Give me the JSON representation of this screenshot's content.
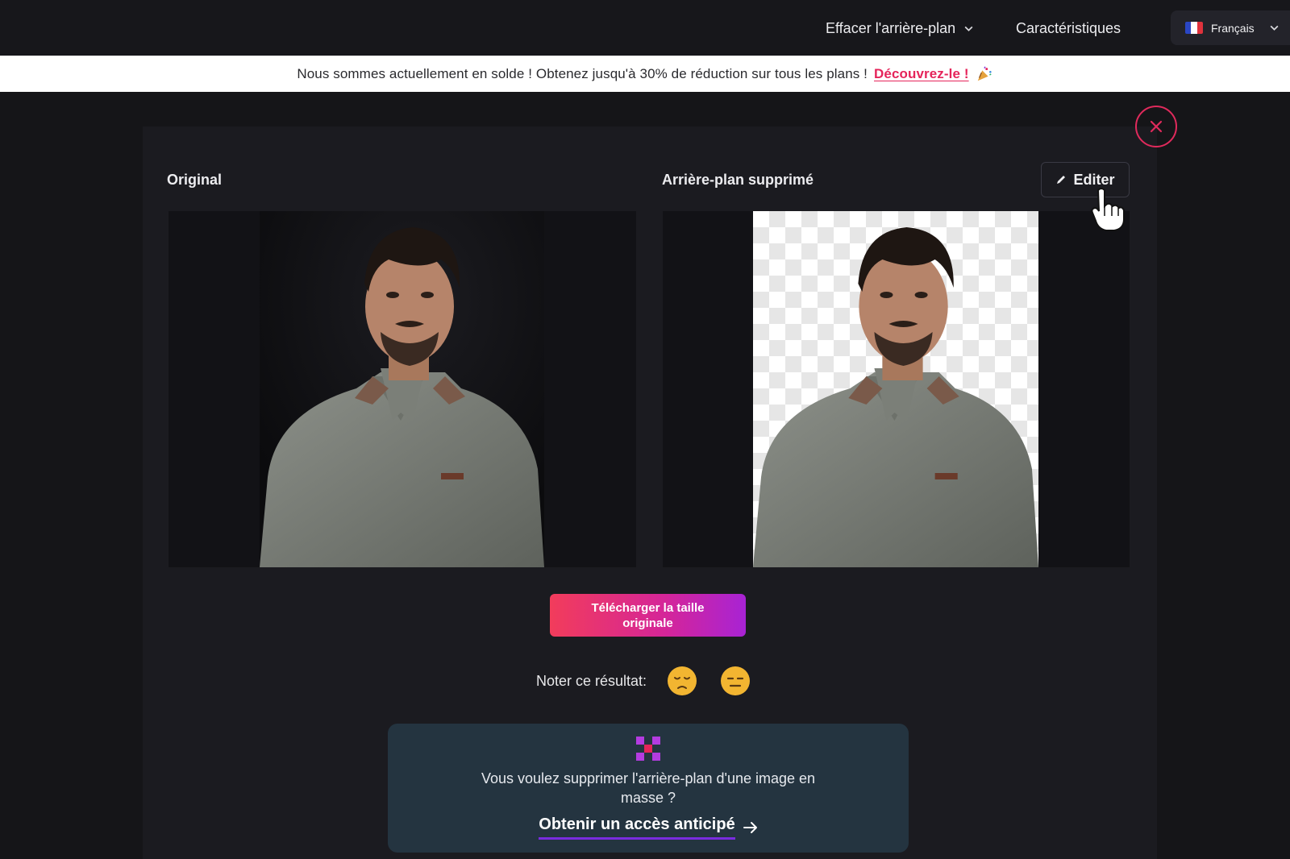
{
  "nav": {
    "remove_bg_label": "Effacer l'arrière-plan",
    "features_label": "Caractéristiques",
    "language_label": "Français"
  },
  "promo": {
    "text": "Nous sommes actuellement en solde ! Obtenez jusqu'à 30% de réduction sur tous les plans !",
    "link": "Découvrez-le !"
  },
  "result": {
    "original_label": "Original",
    "removed_label": "Arrière-plan supprimé",
    "edit_label": "Editer",
    "download_label": "Télécharger la taille originale",
    "rate_label": "Noter ce résultat:"
  },
  "bulk": {
    "text": "Vous voulez supprimer l'arrière-plan d'une image en masse ?",
    "link": "Obtenir un accès anticipé"
  },
  "colors": {
    "accent": "#e5245a",
    "gradient_start": "#f23c5b",
    "gradient_end": "#a823d4",
    "card": "#243440"
  },
  "icons": {
    "language_flag": "france-flag-icon",
    "close": "close-icon",
    "edit": "pencil-icon",
    "bulk": "bulk-grid-icon",
    "rating_1": "sad-face-emoji",
    "rating_2": "neutral-face-emoji"
  }
}
